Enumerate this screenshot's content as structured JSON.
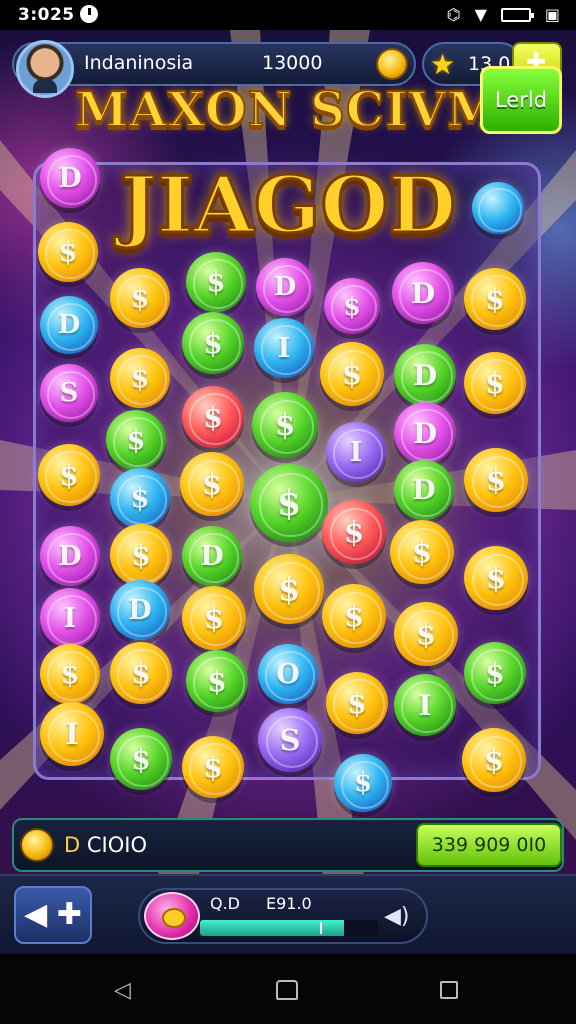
{
  "status_bar": {
    "time": "3:025",
    "signal_icon": "signal-icon",
    "wifi_icon": "wifi-icon",
    "battery_icon": "battery-icon"
  },
  "hud": {
    "player_name": "Indaninosia",
    "coins": "13000",
    "stars": "13.0",
    "menu_icon": "puzzle-icon"
  },
  "titles": {
    "top": "MAXON SCIVM",
    "main": "JIAGOD"
  },
  "coins_board": [
    {
      "color": "pink",
      "symbol": "D"
    },
    {
      "color": "blue",
      "symbol": ""
    },
    {
      "color": "gold",
      "symbol": "$"
    },
    {
      "color": "gold",
      "symbol": "$"
    },
    {
      "color": "green",
      "symbol": "$"
    },
    {
      "color": "pink",
      "symbol": "D"
    },
    {
      "color": "pink",
      "symbol": "$"
    },
    {
      "color": "pink",
      "symbol": "D"
    },
    {
      "color": "gold",
      "symbol": "$"
    },
    {
      "color": "blue",
      "symbol": "D"
    },
    {
      "color": "green",
      "symbol": "$"
    },
    {
      "color": "blue",
      "symbol": "I"
    },
    {
      "color": "gold",
      "symbol": "$"
    },
    {
      "color": "green",
      "symbol": "D"
    },
    {
      "color": "gold",
      "symbol": "$"
    },
    {
      "color": "pink",
      "symbol": "S"
    },
    {
      "color": "gold",
      "symbol": "$"
    },
    {
      "color": "red",
      "symbol": "$"
    },
    {
      "color": "green",
      "symbol": "$"
    },
    {
      "color": "purple",
      "symbol": "I"
    },
    {
      "color": "pink",
      "symbol": "D"
    },
    {
      "color": "gold",
      "symbol": "$"
    },
    {
      "color": "green",
      "symbol": "$"
    },
    {
      "color": "blue",
      "symbol": "$"
    },
    {
      "color": "gold",
      "symbol": "$"
    },
    {
      "color": "green",
      "symbol": "$"
    },
    {
      "color": "green",
      "symbol": "D"
    },
    {
      "color": "gold",
      "symbol": "$"
    },
    {
      "color": "pink",
      "symbol": "D"
    },
    {
      "color": "gold",
      "symbol": "$"
    },
    {
      "color": "green",
      "symbol": "D"
    },
    {
      "color": "red",
      "symbol": "$"
    },
    {
      "color": "gold",
      "symbol": "$"
    },
    {
      "color": "gold",
      "symbol": "$"
    },
    {
      "color": "gold",
      "symbol": "$"
    },
    {
      "color": "pink",
      "symbol": "I"
    },
    {
      "color": "blue",
      "symbol": "D"
    },
    {
      "color": "gold",
      "symbol": "$"
    },
    {
      "color": "gold",
      "symbol": "$"
    },
    {
      "color": "gold",
      "symbol": "$"
    },
    {
      "color": "gold",
      "symbol": "$"
    },
    {
      "color": "gold",
      "symbol": "$"
    },
    {
      "color": "gold",
      "symbol": "$"
    },
    {
      "color": "green",
      "symbol": "$"
    },
    {
      "color": "blue",
      "symbol": "O"
    },
    {
      "color": "gold",
      "symbol": "$"
    },
    {
      "color": "green",
      "symbol": "I"
    },
    {
      "color": "green",
      "symbol": "$"
    },
    {
      "color": "gold",
      "symbol": "I"
    },
    {
      "color": "green",
      "symbol": "$"
    },
    {
      "color": "gold",
      "symbol": "$"
    },
    {
      "color": "purple",
      "symbol": "S"
    },
    {
      "color": "blue",
      "symbol": "$"
    },
    {
      "color": "gold",
      "symbol": "$"
    }
  ],
  "info_bar": {
    "prefix": "D",
    "label": "CIOIO",
    "bet_label": "339 909 0I0"
  },
  "controls": {
    "back_label": "◀ ✚",
    "level": "Q.D",
    "value": "E91.0",
    "progress": 0.81,
    "play_label": "Lerld"
  },
  "colors": {
    "gold": "#ffc20e",
    "green": "#57d52a",
    "pink": "#e250e8",
    "blue": "#2fb4f0",
    "red": "#ff5a5a",
    "purple": "#9a6cf2",
    "accent": "#c8ff5a"
  }
}
